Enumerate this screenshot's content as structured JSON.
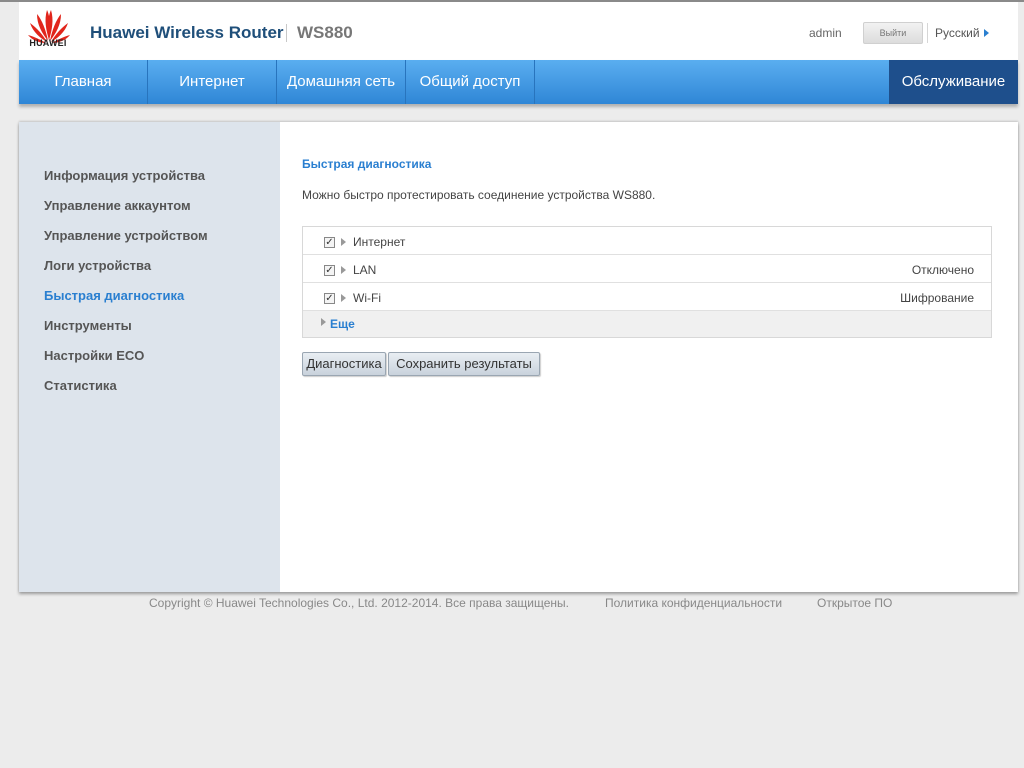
{
  "header": {
    "logo_text": "HUAWEI",
    "title": "Huawei Wireless Router",
    "model": "WS880",
    "user": "admin",
    "logout_label": "Выйти",
    "language": "Русский"
  },
  "nav": {
    "items": [
      {
        "label": "Главная"
      },
      {
        "label": "Интернет"
      },
      {
        "label": "Домашняя сеть"
      },
      {
        "label": "Общий доступ"
      },
      {
        "label": "Обслуживание"
      }
    ],
    "active": "Обслуживание"
  },
  "sidebar": {
    "items": [
      {
        "label": "Информация устройства"
      },
      {
        "label": "Управление аккаунтом"
      },
      {
        "label": "Управление устройством"
      },
      {
        "label": "Логи устройства"
      },
      {
        "label": "Быстрая диагностика"
      },
      {
        "label": "Инструменты"
      },
      {
        "label": "Настройки ECO"
      },
      {
        "label": "Статистика"
      }
    ],
    "active": "Быстрая диагностика"
  },
  "content": {
    "title": "Быстрая диагностика",
    "description": "Можно быстро протестировать соединение устройства WS880.",
    "rows": [
      {
        "label": "Интернет",
        "status": "",
        "checked": true
      },
      {
        "label": "LAN",
        "status": "Отключено",
        "checked": true
      },
      {
        "label": "Wi-Fi",
        "status": "Шифрование",
        "checked": true
      }
    ],
    "more_label": "Еще",
    "diagnose_button": "Диагностика",
    "save_button": "Сохранить результаты"
  },
  "footer": {
    "copyright": "Copyright © Huawei Technologies Co., Ltd. 2012-2014. Все права защищены.",
    "privacy": "Политика конфиденциальности",
    "opensource": "Открытое ПО"
  },
  "colors": {
    "accent": "#2a7fd0",
    "nav_active": "#1e4f8c",
    "logo_red": "#e1251b"
  }
}
